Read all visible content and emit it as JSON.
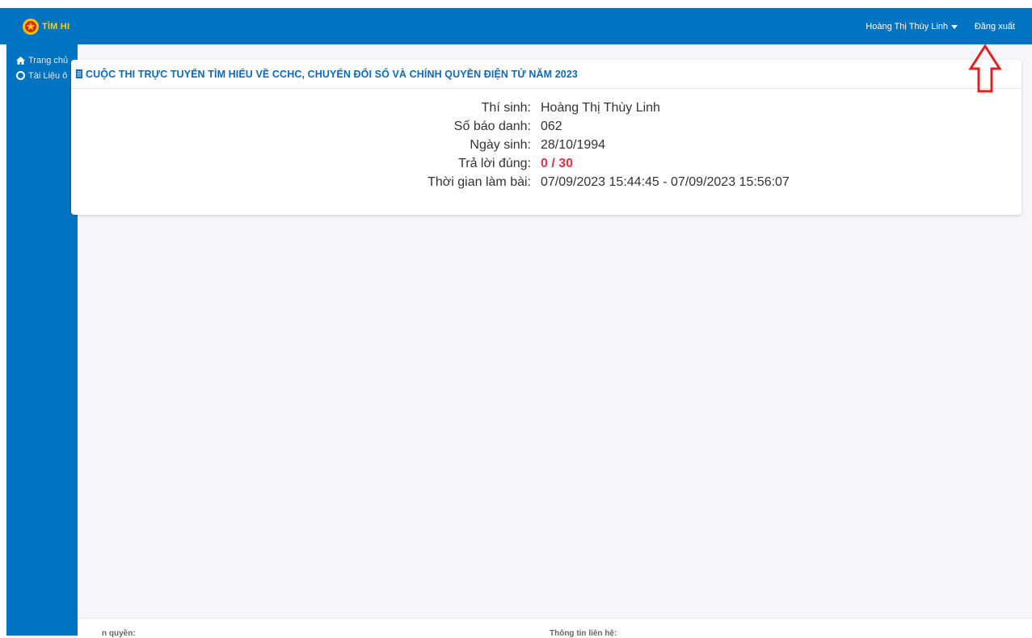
{
  "header": {
    "brand": "TÌM HI",
    "user_name": "Hoàng Thị Thùy Linh",
    "logout_label": "Đăng xuất"
  },
  "sidebar": {
    "items": [
      {
        "label": "Trang chủ",
        "icon": "home-icon"
      },
      {
        "label": "Tài Liệu ô",
        "icon": "circle-icon"
      }
    ]
  },
  "card": {
    "title": "CUỘC THI TRỰC TUYẾN TÌM HIỂU VỀ CCHC, CHUYỂN ĐỔI SỐ VÀ CHÍNH QUYỀN ĐIỆN TỬ NĂM 2023",
    "rows": [
      {
        "label": "Thí sinh:",
        "value": "Hoàng Thị Thùy Linh"
      },
      {
        "label": "Số báo danh:",
        "value": "062"
      },
      {
        "label": "Ngày sinh:",
        "value": "28/10/1994"
      },
      {
        "label": "Trả lời đúng:",
        "value": "0 / 30"
      },
      {
        "label": "Thời gian làm bài:",
        "value": "07/09/2023 15:44:45 - 07/09/2023 15:56:07"
      }
    ]
  },
  "footer": {
    "left_text": "n quyền:",
    "right_text": "Thông tin liên hệ:"
  },
  "colors": {
    "primary": "#0073c1",
    "score": "#dc3545",
    "arrow": "#e02020"
  }
}
